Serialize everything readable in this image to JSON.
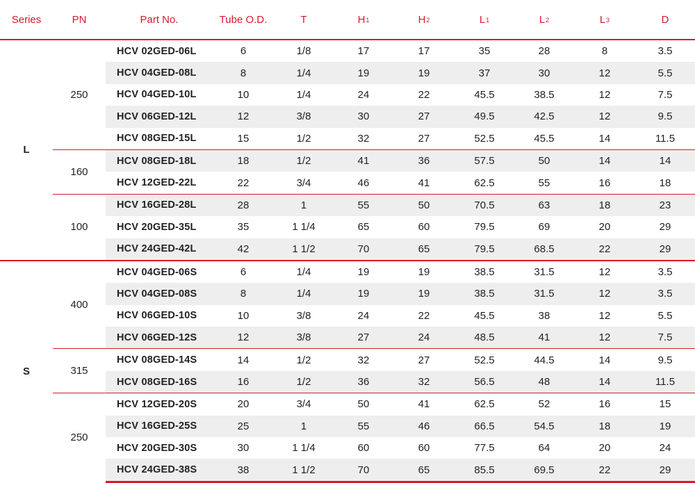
{
  "headers": [
    {
      "main": "Series",
      "sub": ""
    },
    {
      "main": "PN",
      "sub": ""
    },
    {
      "main": "Part No.",
      "sub": ""
    },
    {
      "main": "Tube O.D.",
      "sub": ""
    },
    {
      "main": "T",
      "sub": ""
    },
    {
      "main": "H",
      "sub": "1"
    },
    {
      "main": "H",
      "sub": "2"
    },
    {
      "main": "L",
      "sub": "1"
    },
    {
      "main": "L",
      "sub": "2"
    },
    {
      "main": "L",
      "sub": "3"
    },
    {
      "main": "D",
      "sub": ""
    }
  ],
  "series": [
    {
      "name": "L",
      "groups": [
        {
          "pn": "250",
          "rows": [
            [
              "HCV 02GED-06L",
              "6",
              "1/8",
              "17",
              "17",
              "35",
              "28",
              "8",
              "3.5"
            ],
            [
              "HCV 04GED-08L",
              "8",
              "1/4",
              "19",
              "19",
              "37",
              "30",
              "12",
              "5.5"
            ],
            [
              "HCV 04GED-10L",
              "10",
              "1/4",
              "24",
              "22",
              "45.5",
              "38.5",
              "12",
              "7.5"
            ],
            [
              "HCV 06GED-12L",
              "12",
              "3/8",
              "30",
              "27",
              "49.5",
              "42.5",
              "12",
              "9.5"
            ],
            [
              "HCV 08GED-15L",
              "15",
              "1/2",
              "32",
              "27",
              "52.5",
              "45.5",
              "14",
              "11.5"
            ]
          ]
        },
        {
          "pn": "160",
          "rows": [
            [
              "HCV 08GED-18L",
              "18",
              "1/2",
              "41",
              "36",
              "57.5",
              "50",
              "14",
              "14"
            ],
            [
              "HCV 12GED-22L",
              "22",
              "3/4",
              "46",
              "41",
              "62.5",
              "55",
              "16",
              "18"
            ]
          ]
        },
        {
          "pn": "100",
          "rows": [
            [
              "HCV 16GED-28L",
              "28",
              "1",
              "55",
              "50",
              "70.5",
              "63",
              "18",
              "23"
            ],
            [
              "HCV 20GED-35L",
              "35",
              "1 1/4",
              "65",
              "60",
              "79.5",
              "69",
              "20",
              "29"
            ],
            [
              "HCV 24GED-42L",
              "42",
              "1 1/2",
              "70",
              "65",
              "79.5",
              "68.5",
              "22",
              "29"
            ]
          ]
        }
      ]
    },
    {
      "name": "S",
      "groups": [
        {
          "pn": "400",
          "rows": [
            [
              "HCV 04GED-06S",
              "6",
              "1/4",
              "19",
              "19",
              "38.5",
              "31.5",
              "12",
              "3.5"
            ],
            [
              "HCV 04GED-08S",
              "8",
              "1/4",
              "19",
              "19",
              "38.5",
              "31.5",
              "12",
              "3.5"
            ],
            [
              "HCV 06GED-10S",
              "10",
              "3/8",
              "24",
              "22",
              "45.5",
              "38",
              "12",
              "5.5"
            ],
            [
              "HCV 06GED-12S",
              "12",
              "3/8",
              "27",
              "24",
              "48.5",
              "41",
              "12",
              "7.5"
            ]
          ]
        },
        {
          "pn": "315",
          "rows": [
            [
              "HCV 08GED-14S",
              "14",
              "1/2",
              "32",
              "27",
              "52.5",
              "44.5",
              "14",
              "9.5"
            ],
            [
              "HCV 08GED-16S",
              "16",
              "1/2",
              "36",
              "32",
              "56.5",
              "48",
              "14",
              "11.5"
            ]
          ]
        },
        {
          "pn": "250",
          "rows": [
            [
              "HCV 12GED-20S",
              "20",
              "3/4",
              "50",
              "41",
              "62.5",
              "52",
              "16",
              "15"
            ],
            [
              "HCV 16GED-25S",
              "25",
              "1",
              "55",
              "46",
              "66.5",
              "54.5",
              "18",
              "19"
            ],
            [
              "HCV 20GED-30S",
              "30",
              "1 1/4",
              "60",
              "60",
              "77.5",
              "64",
              "20",
              "24"
            ],
            [
              "HCV 24GED-38S",
              "38",
              "1 1/2",
              "70",
              "65",
              "85.5",
              "69.5",
              "22",
              "29"
            ]
          ]
        }
      ]
    }
  ]
}
